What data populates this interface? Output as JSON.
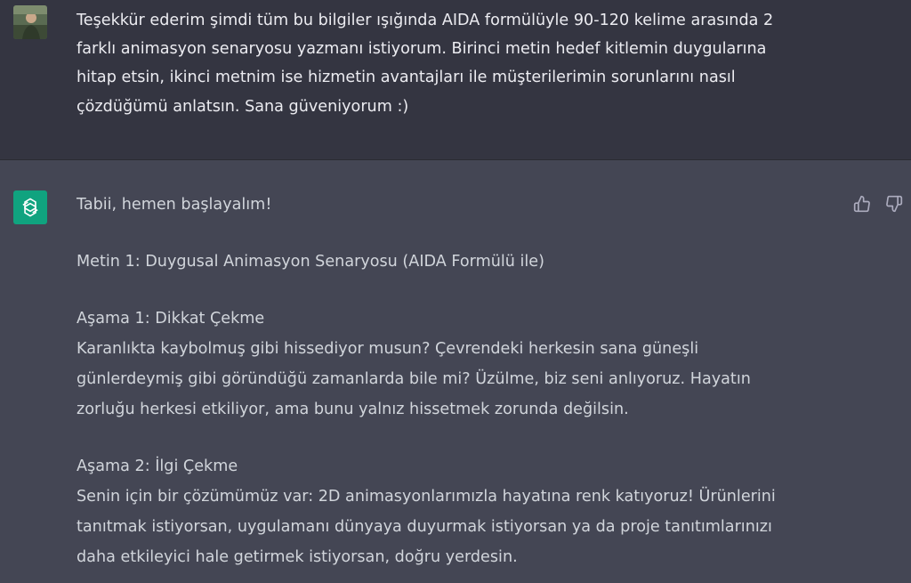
{
  "user_message": {
    "lines": [
      "Teşekkür ederim şimdi tüm bu bilgiler ışığında AIDA formülüyle 90-120 kelime arasında 2",
      "farklı animasyon senaryosu yazmanı istiyorum. Birinci metin hedef kitlemin duygularına",
      "hitap etsin, ikinci metnim ise hizmetin avantajları ile müşterilerimin sorunlarını nasıl",
      "çözdüğümü anlatsın. Sana güveniyorum :)"
    ]
  },
  "assistant_message": {
    "intro": "Tabii, hemen başlayalım!",
    "text1_title": "Metin 1: Duygusal Animasyon Senaryosu (AIDA Formülü ile)",
    "stage1": {
      "heading": "Aşama 1: Dikkat Çekme",
      "lines": [
        "Karanlıkta kaybolmuş gibi hissediyor musun? Çevrendeki herkesin sana güneşli",
        "günlerdeymiş gibi göründüğü zamanlarda bile mi? Üzülme, biz seni anlıyoruz. Hayatın",
        "zorluğu herkesi etkiliyor, ama bunu yalnız hissetmek zorunda değilsin."
      ]
    },
    "stage2": {
      "heading": "Aşama 2: İlgi Çekme",
      "lines": [
        "Senin için bir çözümümüz var: 2D animasyonlarımızla hayatına renk katıyoruz! Ürünlerini",
        "tanıtmak istiyorsan, uygulamanı dünyaya duyurmak istiyorsan ya da proje tanıtımlarınızı",
        "daha etkileyici hale getirmek istiyorsan, doğru yerdesin."
      ]
    }
  },
  "icons": {
    "user_avatar": "user-avatar-photo",
    "bot_avatar": "openai-logo-icon",
    "like": "thumbs-up-icon",
    "dislike": "thumbs-down-icon"
  },
  "colors": {
    "user_bg": "#343541",
    "assistant_bg": "#444654",
    "bot_avatar_bg": "#10a37f",
    "text": "#ececf1"
  }
}
